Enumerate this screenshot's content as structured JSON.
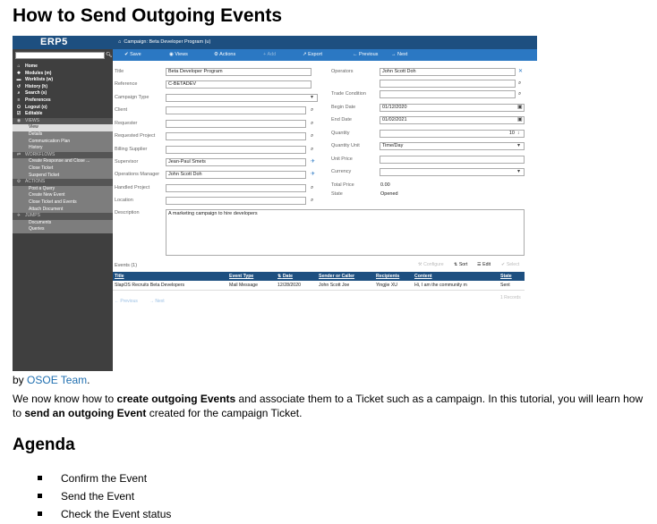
{
  "document": {
    "title": "How to Send Outgoing Events",
    "byline_prefix": "by ",
    "byline_team": "OSOE Team",
    "byline_suffix": ".",
    "intro": {
      "p1": "We now know how to ",
      "b1": "create outgoing Events",
      "p2": " and associate them to a Ticket such as a campaign. In this tutorial, you will learn how to ",
      "b2": "send an outgoing Event",
      "p3": " created for the campaign Ticket."
    },
    "agenda_title": "Agenda",
    "agenda_items": [
      "Confirm the Event",
      "Send the Event",
      "Check the Event status"
    ]
  },
  "screenshot": {
    "logo": "ERP5",
    "header_title": "Campaign: Beta Developer Program (u)",
    "toolbar": {
      "save": "Save",
      "views": "Views",
      "actions": "Actions",
      "add": "Add",
      "export": "Export",
      "previous": "Previous",
      "next": "Next"
    },
    "nav": {
      "home": "Home",
      "modules": "Modules (m)",
      "worklists": "Worklists (w)",
      "history": "History (h)",
      "search": "Search (s)",
      "preferences": "Preferences",
      "logout": "Logout (o)",
      "editable": "Editable"
    },
    "sections": {
      "views": "VIEWS",
      "workflows": "WORKFLOWS",
      "actions": "ACTIONS",
      "jumps": "JUMPS"
    },
    "views_items": [
      "View",
      "Details",
      "Communication Plan",
      "History"
    ],
    "workflow_items": [
      "Create Response and Close ...",
      "Close Ticket",
      "Suspend Ticket"
    ],
    "action_items": [
      "Post a Query",
      "Create New Event",
      "Close Ticket and Events",
      "Attach Document"
    ],
    "jump_items": [
      "Documents",
      "Queries"
    ],
    "left_labels": {
      "title": "Title",
      "reference": "Reference",
      "campaign_type": "Campaign Type",
      "client": "Client",
      "requester": "Requester",
      "requested_project": "Requested Project",
      "billing_supplier": "Billing Supplier",
      "supervisor": "Supervisor",
      "operations_manager": "Operations Manager",
      "handled_project": "Handled Project",
      "location": "Location",
      "description": "Description"
    },
    "left_values": {
      "title": "Beta Developer Program",
      "reference": "C-BETADEV",
      "supervisor": "Jean-Paul Smets",
      "operations_manager": "John Scott Doh",
      "description": "A marketing campaign to hire developers"
    },
    "right_labels": {
      "operators": "Operators",
      "trade_condition": "Trade Condition",
      "begin_date": "Begin Date",
      "end_date": "End Date",
      "quantity": "Quantity",
      "quantity_unit": "Quantity Unit",
      "unit_price": "Unit Price",
      "currency": "Currency",
      "total_price": "Total Price",
      "state": "State"
    },
    "right_values": {
      "operators": "John Scott Doh",
      "begin_date": "01/12/2020",
      "end_date": "01/02/2021",
      "quantity": "10",
      "quantity_unit": "Time/Day",
      "total_price": "0.00",
      "state": "Opened"
    },
    "events": {
      "label": "Events (1)",
      "configure": "Configure",
      "sort": "Sort",
      "edit": "Edit",
      "select": "Select",
      "columns": [
        "Title",
        "Event Type",
        "Date",
        "Sender or Caller",
        "Recipients",
        "Content",
        "State"
      ],
      "rows": [
        [
          "SlapOS Recruits Beta Developers",
          "Mail Message",
          "12/28/2020",
          "John Scott Joe",
          "Yingjie XU",
          "Hi, I am the community m",
          "Sent"
        ]
      ],
      "previous": "Previous",
      "next": "Next",
      "records": "1 Records"
    }
  }
}
